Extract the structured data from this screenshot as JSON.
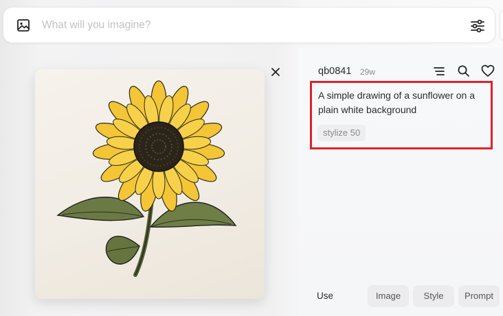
{
  "search": {
    "placeholder": "What will you imagine?"
  },
  "post": {
    "username": "qb0841",
    "age": "29w",
    "prompt": "A simple drawing of a sunflower on a plain white background",
    "param_chip": "stylize 50",
    "image_alt": "Drawing of a sunflower"
  },
  "actions": {
    "use_label": "Use",
    "image_label": "Image",
    "style_label": "Style",
    "prompt_label": "Prompt"
  },
  "icons": {
    "image": "image-icon",
    "filter": "sliders-icon",
    "close": "close-icon",
    "menu": "lines-icon",
    "search": "search-icon",
    "like": "heart-icon"
  },
  "colors": {
    "highlight": "#e0202a",
    "petal": "#f3c537",
    "leaf": "#6b7a45"
  }
}
